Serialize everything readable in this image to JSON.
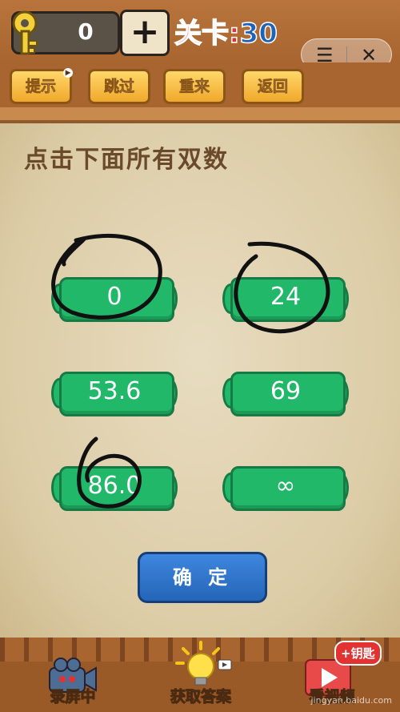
{
  "header": {
    "key_count": "0",
    "plus_label": "+",
    "level_label": "关卡:",
    "level_number": "30",
    "menu_icon": "menu-icon",
    "close_icon": "close-icon"
  },
  "actions": [
    {
      "label": "提示"
    },
    {
      "label": "跳过"
    },
    {
      "label": "重来"
    },
    {
      "label": "返回"
    }
  ],
  "question": "点击下面所有双数",
  "options": [
    "0",
    "24",
    "53.6",
    "69",
    "86.0",
    "∞"
  ],
  "confirm_label": "确 定",
  "bottom": {
    "record": "录屏中",
    "answer": "获取答案",
    "video": "看视频",
    "key_badge": "+钥匙",
    "watermark": "jingyan.baidu.com"
  },
  "colors": {
    "option_green": "#22b86a",
    "confirm_blue": "#2466b8",
    "level_red": "#e23232",
    "level_blue": "#1f63b8"
  }
}
